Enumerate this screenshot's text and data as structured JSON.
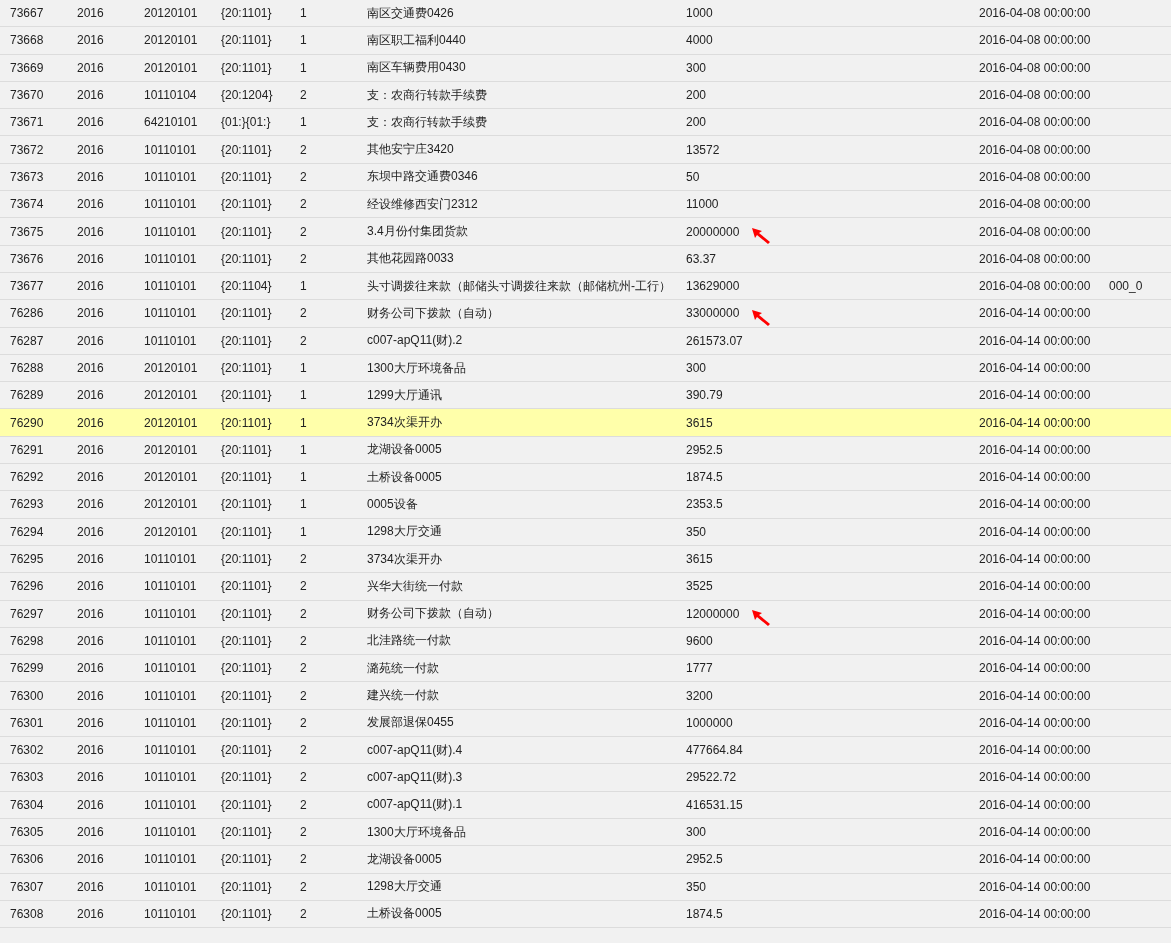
{
  "table": {
    "rows": [
      {
        "cells": [
          "73667",
          "2016",
          "20120101",
          "{20:1101}",
          "1",
          "南区交通费0426",
          "1000",
          "2016-04-08 00:00:00"
        ],
        "selected": false,
        "arrow": false
      },
      {
        "cells": [
          "73668",
          "2016",
          "20120101",
          "{20:1101}",
          "1",
          "南区职工福利0440",
          "4000",
          "2016-04-08 00:00:00"
        ],
        "selected": false,
        "arrow": false
      },
      {
        "cells": [
          "73669",
          "2016",
          "20120101",
          "{20:1101}",
          "1",
          "南区车辆费用0430",
          "300",
          "2016-04-08 00:00:00"
        ],
        "selected": false,
        "arrow": false
      },
      {
        "cells": [
          "73670",
          "2016",
          "10110104",
          "{20:1204}",
          "2",
          "支：农商行转款手续费",
          "200",
          "2016-04-08 00:00:00"
        ],
        "selected": false,
        "arrow": false
      },
      {
        "cells": [
          "73671",
          "2016",
          "64210101",
          "{01:}{01:}",
          "1",
          "支：农商行转款手续费",
          "200",
          "2016-04-08 00:00:00"
        ],
        "selected": false,
        "arrow": false
      },
      {
        "cells": [
          "73672",
          "2016",
          "10110101",
          "{20:1101}",
          "2",
          "其他安宁庄3420",
          "13572",
          "2016-04-08 00:00:00"
        ],
        "selected": false,
        "arrow": false
      },
      {
        "cells": [
          "73673",
          "2016",
          "10110101",
          "{20:1101}",
          "2",
          "东坝中路交通费0346",
          "50",
          "2016-04-08 00:00:00"
        ],
        "selected": false,
        "arrow": false
      },
      {
        "cells": [
          "73674",
          "2016",
          "10110101",
          "{20:1101}",
          "2",
          "经设维修西安门2312",
          "11000",
          "2016-04-08 00:00:00"
        ],
        "selected": false,
        "arrow": false
      },
      {
        "cells": [
          "73675",
          "2016",
          "10110101",
          "{20:1101}",
          "2",
          "3.4月份付集团货款",
          "20000000",
          "2016-04-08 00:00:00"
        ],
        "selected": false,
        "arrow": true
      },
      {
        "cells": [
          "73676",
          "2016",
          "10110101",
          "{20:1101}",
          "2",
          "其他花园路0033",
          "63.37",
          "2016-04-08 00:00:00"
        ],
        "selected": false,
        "arrow": false
      },
      {
        "cells": [
          "73677",
          "2016",
          "10110101",
          "{20:1104}",
          "1",
          "头寸调拨往来款（邮储头寸调拨往来款（邮储杭州-工行）",
          "13629000",
          "2016-04-08 00:00:00",
          "000_0"
        ],
        "selected": false,
        "arrow": false
      },
      {
        "cells": [
          "76286",
          "2016",
          "10110101",
          "{20:1101}",
          "2",
          "财务公司下拨款（自动）",
          "33000000",
          "2016-04-14 00:00:00"
        ],
        "selected": false,
        "arrow": true
      },
      {
        "cells": [
          "76287",
          "2016",
          "10110101",
          "{20:1101}",
          "2",
          "c007-apQ11(财).2",
          "261573.07",
          "2016-04-14 00:00:00"
        ],
        "selected": false,
        "arrow": false
      },
      {
        "cells": [
          "76288",
          "2016",
          "20120101",
          "{20:1101}",
          "1",
          "1300大厅环境备品",
          "300",
          "2016-04-14 00:00:00"
        ],
        "selected": false,
        "arrow": false
      },
      {
        "cells": [
          "76289",
          "2016",
          "20120101",
          "{20:1101}",
          "1",
          "1299大厅通讯",
          "390.79",
          "2016-04-14 00:00:00"
        ],
        "selected": false,
        "arrow": false
      },
      {
        "cells": [
          "76290",
          "2016",
          "20120101",
          "{20:1101}",
          "1",
          "3734次渠开办",
          "3615",
          "2016-04-14 00:00:00"
        ],
        "selected": true,
        "arrow": false
      },
      {
        "cells": [
          "76291",
          "2016",
          "20120101",
          "{20:1101}",
          "1",
          "龙湖设备0005",
          "2952.5",
          "2016-04-14 00:00:00"
        ],
        "selected": false,
        "arrow": false
      },
      {
        "cells": [
          "76292",
          "2016",
          "20120101",
          "{20:1101}",
          "1",
          "土桥设备0005",
          "1874.5",
          "2016-04-14 00:00:00"
        ],
        "selected": false,
        "arrow": false
      },
      {
        "cells": [
          "76293",
          "2016",
          "20120101",
          "{20:1101}",
          "1",
          "0005设备",
          "2353.5",
          "2016-04-14 00:00:00"
        ],
        "selected": false,
        "arrow": false
      },
      {
        "cells": [
          "76294",
          "2016",
          "20120101",
          "{20:1101}",
          "1",
          "1298大厅交通",
          "350",
          "2016-04-14 00:00:00"
        ],
        "selected": false,
        "arrow": false
      },
      {
        "cells": [
          "76295",
          "2016",
          "10110101",
          "{20:1101}",
          "2",
          "3734次渠开办",
          "3615",
          "2016-04-14 00:00:00"
        ],
        "selected": false,
        "arrow": false
      },
      {
        "cells": [
          "76296",
          "2016",
          "10110101",
          "{20:1101}",
          "2",
          "兴华大街统一付款",
          "3525",
          "2016-04-14 00:00:00"
        ],
        "selected": false,
        "arrow": false
      },
      {
        "cells": [
          "76297",
          "2016",
          "10110101",
          "{20:1101}",
          "2",
          "财务公司下拨款（自动）",
          "12000000",
          "2016-04-14 00:00:00"
        ],
        "selected": false,
        "arrow": true
      },
      {
        "cells": [
          "76298",
          "2016",
          "10110101",
          "{20:1101}",
          "2",
          "北洼路统一付款",
          "9600",
          "2016-04-14 00:00:00"
        ],
        "selected": false,
        "arrow": false
      },
      {
        "cells": [
          "76299",
          "2016",
          "10110101",
          "{20:1101}",
          "2",
          "潞苑统一付款",
          "1777",
          "2016-04-14 00:00:00"
        ],
        "selected": false,
        "arrow": false
      },
      {
        "cells": [
          "76300",
          "2016",
          "10110101",
          "{20:1101}",
          "2",
          "建兴统一付款",
          "3200",
          "2016-04-14 00:00:00"
        ],
        "selected": false,
        "arrow": false
      },
      {
        "cells": [
          "76301",
          "2016",
          "10110101",
          "{20:1101}",
          "2",
          "发展部退保0455",
          "1000000",
          "2016-04-14 00:00:00"
        ],
        "selected": false,
        "arrow": false
      },
      {
        "cells": [
          "76302",
          "2016",
          "10110101",
          "{20:1101}",
          "2",
          "c007-apQ11(财).4",
          "477664.84",
          "2016-04-14 00:00:00"
        ],
        "selected": false,
        "arrow": false
      },
      {
        "cells": [
          "76303",
          "2016",
          "10110101",
          "{20:1101}",
          "2",
          "c007-apQ11(财).3",
          "29522.72",
          "2016-04-14 00:00:00"
        ],
        "selected": false,
        "arrow": false
      },
      {
        "cells": [
          "76304",
          "2016",
          "10110101",
          "{20:1101}",
          "2",
          "c007-apQ11(财).1",
          "416531.15",
          "2016-04-14 00:00:00"
        ],
        "selected": false,
        "arrow": false
      },
      {
        "cells": [
          "76305",
          "2016",
          "10110101",
          "{20:1101}",
          "2",
          "1300大厅环境备品",
          "300",
          "2016-04-14 00:00:00"
        ],
        "selected": false,
        "arrow": false
      },
      {
        "cells": [
          "76306",
          "2016",
          "10110101",
          "{20:1101}",
          "2",
          "龙湖设备0005",
          "2952.5",
          "2016-04-14 00:00:00"
        ],
        "selected": false,
        "arrow": false
      },
      {
        "cells": [
          "76307",
          "2016",
          "10110101",
          "{20:1101}",
          "2",
          "1298大厅交通",
          "350",
          "2016-04-14 00:00:00"
        ],
        "selected": false,
        "arrow": false
      },
      {
        "cells": [
          "76308",
          "2016",
          "10110101",
          "{20:1101}",
          "2",
          "土桥设备0005",
          "1874.5",
          "2016-04-14 00:00:00"
        ],
        "selected": false,
        "arrow": false
      }
    ]
  }
}
